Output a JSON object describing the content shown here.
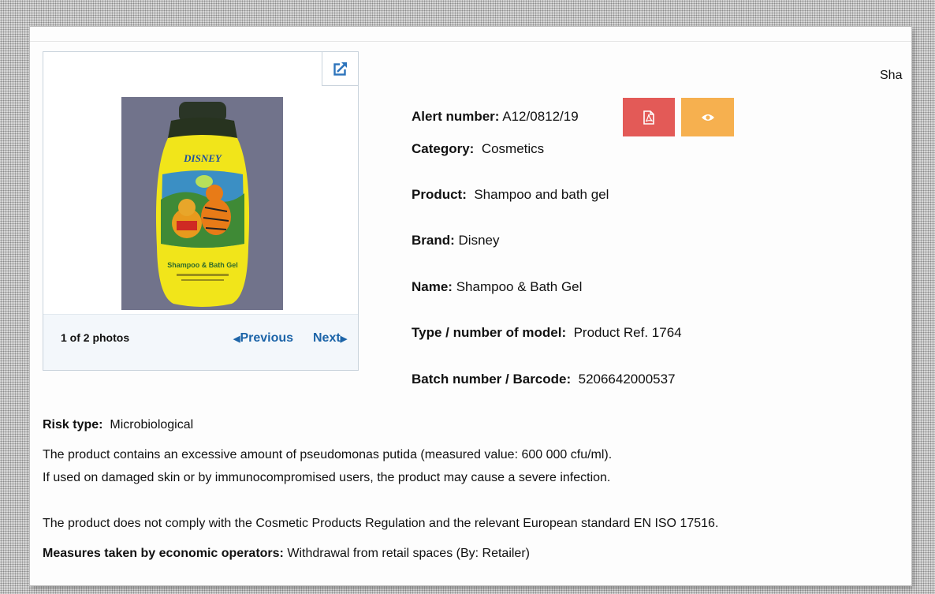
{
  "header": {
    "partial_label": "Sha"
  },
  "gallery": {
    "counter": "1 of 2 photos",
    "previous_label": "Previous",
    "next_label": "Next",
    "previous_icon": "caret-left-icon",
    "next_icon": "caret-right-icon",
    "expand_icon": "external-link-icon",
    "photo_brand_text": "DISNEY",
    "photo_product_text": "Shampoo & Bath Gel"
  },
  "details": {
    "alert_label": "Alert number:",
    "alert_value": "A12/0812/19",
    "category_label": "Category:",
    "category_value": "Cosmetics",
    "product_label": "Product:",
    "product_value": "Shampoo and bath gel",
    "brand_label": "Brand:",
    "brand_value": "Disney",
    "name_label": "Name:",
    "name_value": "Shampoo & Bath Gel",
    "model_label": "Type / number of model:",
    "model_value": "Product Ref. 1764",
    "batch_label": "Batch number / Barcode:",
    "batch_value": "5206642000537"
  },
  "buttons": {
    "pdf_icon": "pdf-icon",
    "view_icon": "eye-icon",
    "pdf_color": "#e35a57",
    "view_color": "#f6b04f"
  },
  "risk": {
    "label": "Risk type:",
    "value": "Microbiological",
    "description_1": "The product contains an excessive amount of pseudomonas putida (measured value: 600 000 cfu/ml).",
    "description_2": "If used on damaged skin or by immunocompromised users, the product may cause a severe infection.",
    "compliance": "The product does not comply with the Cosmetic Products Regulation and the relevant European standard EN ISO 17516."
  },
  "measures": {
    "label": "Measures taken by economic operators:",
    "value": "Withdrawal from retail spaces  (By: Retailer)"
  }
}
